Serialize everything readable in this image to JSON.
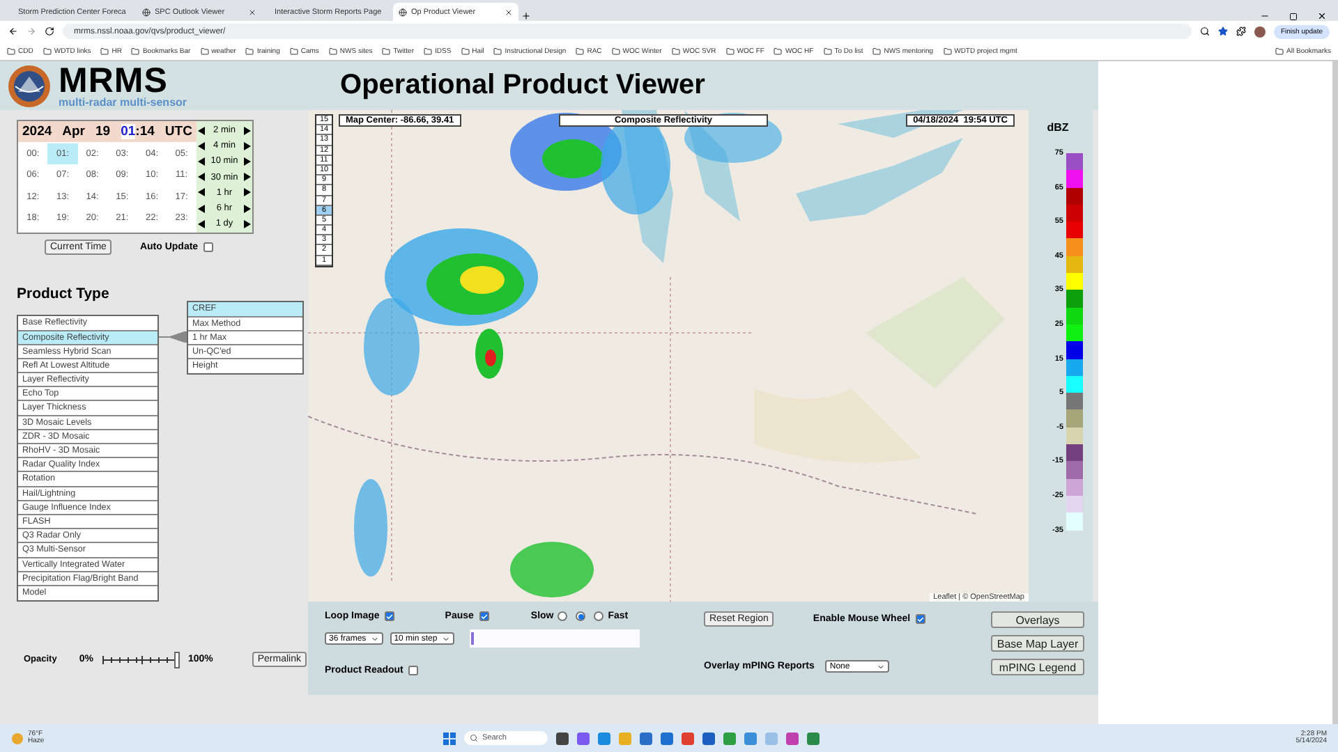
{
  "browser": {
    "tabs": [
      {
        "label": "Storm Prediction Center Foreca",
        "selected": false
      },
      {
        "label": "SPC Outlook Viewer",
        "selected": false
      },
      {
        "label": "Interactive Storm Reports Page",
        "selected": false
      },
      {
        "label": "Op Product Viewer",
        "selected": true
      }
    ],
    "url": "mrms.nssl.noaa.gov/qvs/product_viewer/",
    "update_button": "Finish update",
    "bookmarks": [
      "CDD",
      "WDTD links",
      "HR",
      "Bookmarks Bar",
      "weather",
      "training",
      "Cams",
      "NWS sites",
      "Twitter",
      "IDSS",
      "Hail",
      "Instructional Design",
      "RAC",
      "WOC Winter",
      "WOC SVR",
      "WOC FF",
      "WOC HF",
      "To Do list",
      "NWS mentoring",
      "WDTD project mgmt"
    ],
    "all_bookmarks": "All Bookmarks"
  },
  "header": {
    "logo_title": "MRMS",
    "logo_subtitle": "multi-radar multi-sensor",
    "title": "Operational Product Viewer"
  },
  "time": {
    "year": "2024",
    "month": "Apr",
    "day": "19",
    "hour": "01",
    "separator": ":",
    "minute": "14",
    "zone": "UTC",
    "hours": [
      {
        "label": "00:",
        "selected": false
      },
      {
        "label": "01:",
        "selected": true
      },
      {
        "label": "02:",
        "selected": false
      },
      {
        "label": "03:",
        "selected": false
      },
      {
        "label": "04:",
        "selected": false
      },
      {
        "label": "05:",
        "selected": false
      },
      {
        "label": "06:",
        "selected": false
      },
      {
        "label": "07:",
        "selected": false
      },
      {
        "label": "08:",
        "selected": false
      },
      {
        "label": "09:",
        "selected": false
      },
      {
        "label": "10:",
        "selected": false
      },
      {
        "label": "11:",
        "selected": false
      },
      {
        "label": "12:",
        "selected": false
      },
      {
        "label": "13:",
        "selected": false
      },
      {
        "label": "14:",
        "selected": false
      },
      {
        "label": "15:",
        "selected": false
      },
      {
        "label": "16:",
        "selected": false
      },
      {
        "label": "17:",
        "selected": false
      },
      {
        "label": "18:",
        "selected": false
      },
      {
        "label": "19:",
        "selected": false
      },
      {
        "label": "20:",
        "selected": false
      },
      {
        "label": "21:",
        "selected": false
      },
      {
        "label": "22:",
        "selected": false
      },
      {
        "label": "23:",
        "selected": false
      }
    ],
    "steps": [
      "2 min",
      "4 min",
      "10 min",
      "30 min",
      "1 hr",
      "6 hr",
      "1 dy"
    ],
    "current_time_button": "Current Time",
    "auto_update": {
      "label": "Auto Update",
      "checked": false
    }
  },
  "product_type": {
    "heading": "Product Type",
    "items": [
      {
        "label": "Base Reflectivity",
        "selected": false
      },
      {
        "label": "Composite Reflectivity",
        "selected": true
      },
      {
        "label": "Seamless Hybrid Scan",
        "selected": false
      },
      {
        "label": "Refl At Lowest Altitude",
        "selected": false
      },
      {
        "label": "Layer Reflectivity",
        "selected": false
      },
      {
        "label": "Echo Top",
        "selected": false
      },
      {
        "label": "Layer Thickness",
        "selected": false
      },
      {
        "label": "3D Mosaic Levels",
        "selected": false
      },
      {
        "label": "ZDR - 3D Mosaic",
        "selected": false
      },
      {
        "label": "RhoHV - 3D Mosaic",
        "selected": false
      },
      {
        "label": "Radar Quality Index",
        "selected": false
      },
      {
        "label": "Rotation",
        "selected": false
      },
      {
        "label": "Hail/Lightning",
        "selected": false
      },
      {
        "label": "Gauge Influence Index",
        "selected": false
      },
      {
        "label": "FLASH",
        "selected": false
      },
      {
        "label": "Q3 Radar Only",
        "selected": false
      },
      {
        "label": "Q3 Multi-Sensor",
        "selected": false
      },
      {
        "label": "Vertically Integrated Water",
        "selected": false
      },
      {
        "label": "Precipitation Flag/Bright Band",
        "selected": false
      },
      {
        "label": "Model",
        "selected": false
      }
    ],
    "subitems": [
      {
        "label": "CREF",
        "selected": true
      },
      {
        "label": "Max Method",
        "selected": false
      },
      {
        "label": "1 hr Max",
        "selected": false
      },
      {
        "label": "Un-QC'ed",
        "selected": false
      },
      {
        "label": "Height",
        "selected": false
      }
    ]
  },
  "opacity": {
    "label": "Opacity",
    "min": "0%",
    "max": "100%",
    "level": 1
  },
  "permalink": "Permalink",
  "map": {
    "center": "Map Center: -86.66, 39.41",
    "product": "Composite Reflectivity",
    "datetime": "04/18/2024  19:54 UTC",
    "levels": [
      {
        "label": "15",
        "selected": false
      },
      {
        "label": "14",
        "selected": false
      },
      {
        "label": "13",
        "selected": false
      },
      {
        "label": "12",
        "selected": false
      },
      {
        "label": "11",
        "selected": false
      },
      {
        "label": "10",
        "selected": false
      },
      {
        "label": "9",
        "selected": false
      },
      {
        "label": "8",
        "selected": false
      },
      {
        "label": "7",
        "selected": false
      },
      {
        "label": "6",
        "selected": true
      },
      {
        "label": "5",
        "selected": false
      },
      {
        "label": "4",
        "selected": false
      },
      {
        "label": "3",
        "selected": false
      },
      {
        "label": "2",
        "selected": false
      },
      {
        "label": "1",
        "selected": false
      }
    ],
    "attribution": "Leaflet | © OpenStreetMap"
  },
  "legend": {
    "unit": "dBZ",
    "ticks": [
      "75",
      "65",
      "55",
      "45",
      "35",
      "25",
      "15",
      "5",
      "-5",
      "-15",
      "-25",
      "-35"
    ],
    "bins": [
      {
        "color": "#9b4fc4"
      },
      {
        "color": "#ee11ee"
      },
      {
        "color": "#b00000"
      },
      {
        "color": "#cc0000"
      },
      {
        "color": "#e80000"
      },
      {
        "color": "#f7901a"
      },
      {
        "color": "#e4b810"
      },
      {
        "color": "#ffff00"
      },
      {
        "color": "#0ba00b"
      },
      {
        "color": "#10d810"
      },
      {
        "color": "#10f010"
      },
      {
        "color": "#0000e8"
      },
      {
        "color": "#18a8f0"
      },
      {
        "color": "#18ffff"
      },
      {
        "color": "#777777"
      },
      {
        "color": "#a6a67a"
      },
      {
        "color": "#d8d4b0"
      },
      {
        "color": "#74407e"
      },
      {
        "color": "#9e6aa8"
      },
      {
        "color": "#cea6d8"
      },
      {
        "color": "#e4d4ee"
      },
      {
        "color": "#e4ffff"
      }
    ]
  },
  "controls": {
    "loop_image": {
      "label": "Loop Image",
      "checked": true
    },
    "pause": {
      "label": "Pause",
      "checked": true
    },
    "speed": {
      "slow_label": "Slow",
      "fast_label": "Fast",
      "options": [
        {
          "selected": false
        },
        {
          "selected": true
        },
        {
          "selected": false
        }
      ]
    },
    "frames": "36 frames",
    "step": "10 min step",
    "loop_progress": {
      "level": 0.03
    },
    "product_readout": {
      "label": "Product Readout",
      "checked": false
    },
    "reset_region": "Reset Region",
    "mouse_wheel": {
      "label": "Enable Mouse Wheel",
      "checked": true
    },
    "mping": {
      "label": "Overlay mPING Reports",
      "value": "None"
    },
    "buttons": [
      "Overlays",
      "Base Map Layer",
      "mPING Legend"
    ]
  },
  "taskbar": {
    "temperature": "76°F",
    "condition": "Haze",
    "search_placeholder": "Search",
    "time": "2:28 PM",
    "date": "5/14/2024"
  }
}
